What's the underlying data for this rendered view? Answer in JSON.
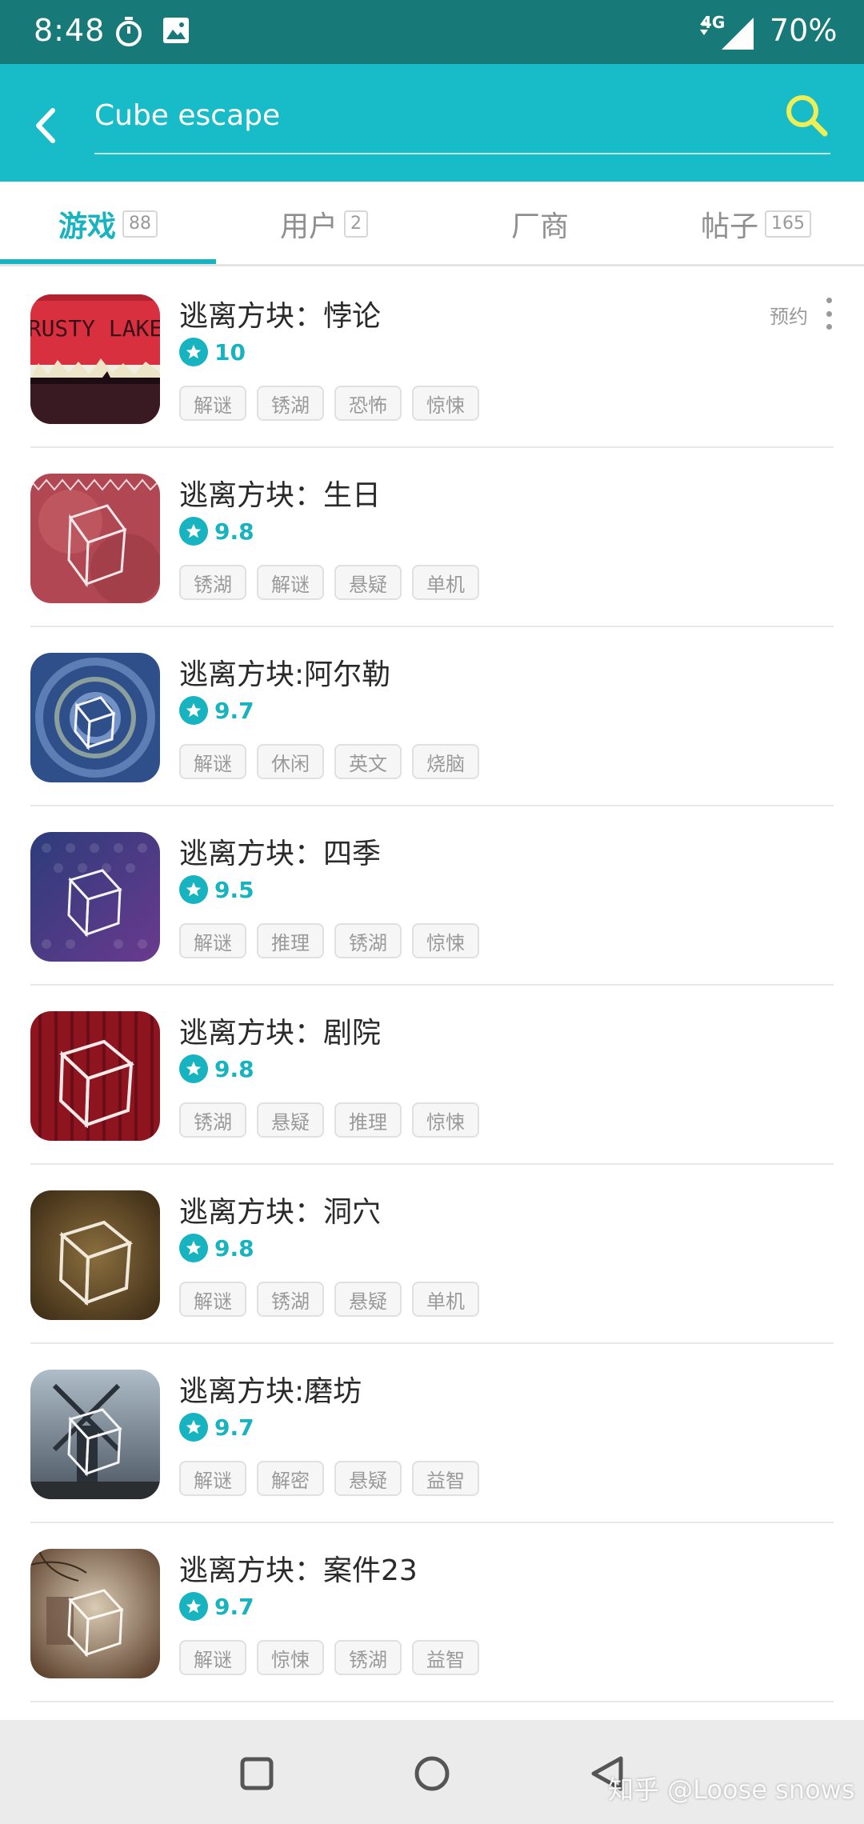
{
  "status_bar": {
    "time": "8:48",
    "network": "4G",
    "battery": "70%"
  },
  "search": {
    "value": "Cube escape",
    "placeholder": ""
  },
  "tabs": [
    {
      "label": "游戏",
      "count": "88",
      "active": true
    },
    {
      "label": "用户",
      "count": "2",
      "active": false
    },
    {
      "label": "厂商",
      "count": "",
      "active": false
    },
    {
      "label": "帖子",
      "count": "165",
      "active": false
    }
  ],
  "first_item_action": "预约",
  "games": [
    {
      "title": "逃离方块：悖论",
      "rating": "10",
      "tags": [
        "解谜",
        "锈湖",
        "恐怖",
        "惊悚"
      ],
      "icon": "rusty-lake-icon"
    },
    {
      "title": "逃离方块：生日",
      "rating": "9.8",
      "tags": [
        "锈湖",
        "解谜",
        "悬疑",
        "单机"
      ],
      "icon": "cube-birthday-icon"
    },
    {
      "title": "逃离方块:阿尔勒",
      "rating": "9.7",
      "tags": [
        "解谜",
        "休闲",
        "英文",
        "烧脑"
      ],
      "icon": "cube-arles-icon"
    },
    {
      "title": "逃离方块：四季",
      "rating": "9.5",
      "tags": [
        "解谜",
        "推理",
        "锈湖",
        "惊悚"
      ],
      "icon": "cube-seasons-icon"
    },
    {
      "title": "逃离方块：剧院",
      "rating": "9.8",
      "tags": [
        "锈湖",
        "悬疑",
        "推理",
        "惊悚"
      ],
      "icon": "cube-theatre-icon"
    },
    {
      "title": "逃离方块：洞穴",
      "rating": "9.8",
      "tags": [
        "解谜",
        "锈湖",
        "悬疑",
        "单机"
      ],
      "icon": "cube-cave-icon"
    },
    {
      "title": "逃离方块:磨坊",
      "rating": "9.7",
      "tags": [
        "解谜",
        "解密",
        "悬疑",
        "益智"
      ],
      "icon": "cube-mill-icon"
    },
    {
      "title": "逃离方块：案件23",
      "rating": "9.7",
      "tags": [
        "解谜",
        "惊悚",
        "锈湖",
        "益智"
      ],
      "icon": "cube-case23-icon"
    }
  ],
  "watermark": "知乎 @Loose snows",
  "colors": {
    "accent": "#17b3c0",
    "header": "#17bcc8",
    "status_bar": "#187a78",
    "search_icon": "#f0ee55"
  }
}
